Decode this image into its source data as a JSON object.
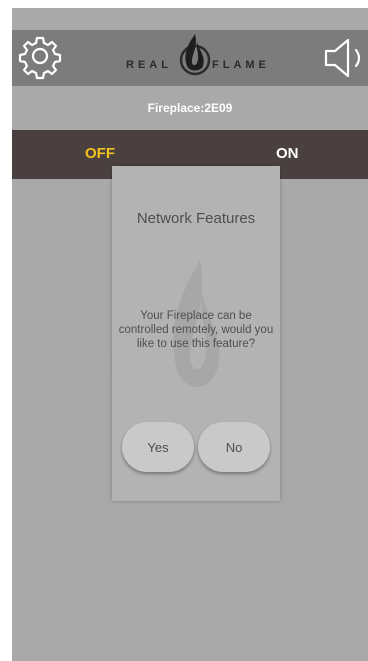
{
  "header": {
    "logo_left": "REAL",
    "logo_right": "FLAME",
    "settings_icon": "gear-icon",
    "sound_icon": "speaker-icon"
  },
  "device": {
    "name": "Fireplace:2E09"
  },
  "power": {
    "off_label": "OFF",
    "on_label": "ON",
    "state": "off",
    "off_color": "#f2c21e"
  },
  "dialog": {
    "title": "Network Features",
    "message": "Your Fireplace can be controlled remotely, would you like to use this feature?",
    "yes_label": "Yes",
    "no_label": "No"
  },
  "colors": {
    "header_bg": "#7c7c7c",
    "power_bar_bg": "#4a4040",
    "screen_bg": "#a9a9a9"
  }
}
